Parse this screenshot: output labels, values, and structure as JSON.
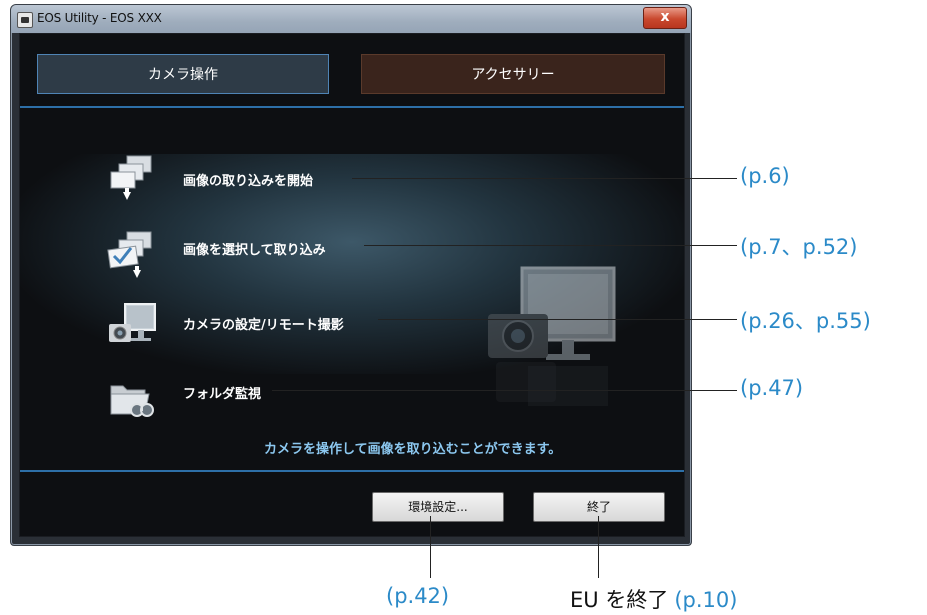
{
  "window": {
    "title": "EOS Utility -  EOS XXX",
    "close_label": "x"
  },
  "tabs": [
    {
      "label": "カメラ操作",
      "active": true
    },
    {
      "label": "アクセサリー",
      "active": false
    }
  ],
  "menu": [
    {
      "label": "画像の取り込みを開始",
      "icon": "download-images-icon",
      "ref": "(p.6)"
    },
    {
      "label": "画像を選択して取り込み",
      "icon": "select-download-icon",
      "ref": "(p.7、p.52)"
    },
    {
      "label": "カメラの設定/リモート撮影",
      "icon": "camera-monitor-icon",
      "ref": "(p.26、p.55)"
    },
    {
      "label": "フォルダ監視",
      "icon": "folder-watch-icon",
      "ref": "(p.47)"
    }
  ],
  "info_text": "カメラを操作して画像を取り込むことができます。",
  "buttons": {
    "settings": "環境設定...",
    "quit": "終了"
  },
  "annotations": {
    "settings_ref": "(p.42)",
    "quit_label": "EU を終了",
    "quit_ref": "(p.10)"
  },
  "colors": {
    "accent": "#2d6fa7",
    "reference": "#2b8ac8",
    "info_text": "#8cc8f0"
  }
}
